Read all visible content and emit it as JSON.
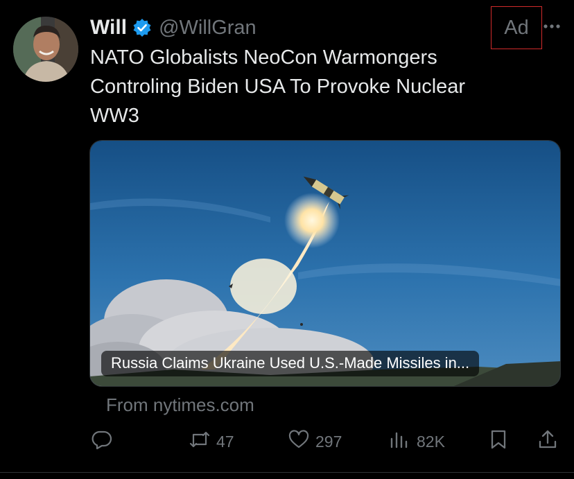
{
  "author": {
    "name": "Will",
    "handle": "@WillGran",
    "verified": true
  },
  "ad_label": "Ad",
  "more_icon": "ellipsis-icon",
  "tweet_text": "NATO Globalists NeoCon Warmongers\nControling Biden USA To Provoke Nuclear\nWW3",
  "card": {
    "headline": "Russia Claims Ukraine Used U.S.-Made Missiles in...",
    "image_subject": "missile launch against blue sky"
  },
  "source": "From nytimes.com",
  "actions": {
    "reply": {
      "icon": "reply-icon",
      "count": ""
    },
    "retweet": {
      "icon": "retweet-icon",
      "count": "47"
    },
    "like": {
      "icon": "heart-icon",
      "count": "297"
    },
    "views": {
      "icon": "views-icon",
      "count": "82K"
    },
    "bookmark": {
      "icon": "bookmark-icon"
    },
    "share": {
      "icon": "share-icon"
    }
  },
  "colors": {
    "background": "#000000",
    "text": "#e7e9ea",
    "muted": "#71767b",
    "verified": "#1d9bf0",
    "ad_outline": "#d22b2b"
  }
}
